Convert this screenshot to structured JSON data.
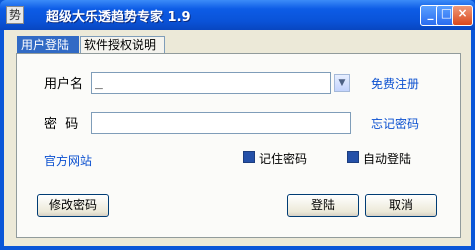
{
  "window": {
    "title": "超级大乐透趋势专家 1.9",
    "icon_glyph": "势",
    "controls": {
      "minimize": "_",
      "maximize": "□",
      "close": "×"
    }
  },
  "tabs": [
    {
      "label": "用户登陆",
      "selected": true
    },
    {
      "label": "软件授权说明",
      "selected": false
    }
  ],
  "form": {
    "username_label": "用户名",
    "username_value": "_",
    "password_label": "密  码",
    "password_value": "",
    "register_link": "免费注册",
    "forgot_link": "忘记密码",
    "website_link": "官方网站",
    "remember_label": "记住密码",
    "remember_checked": true,
    "autologin_label": "自动登陆",
    "autologin_checked": true
  },
  "buttons": {
    "change_password": "修改密码",
    "login": "登陆",
    "cancel": "取消"
  },
  "colors": {
    "title_bar": "#0a53d8",
    "link": "#0b50d0",
    "face": "#ece9d8"
  }
}
